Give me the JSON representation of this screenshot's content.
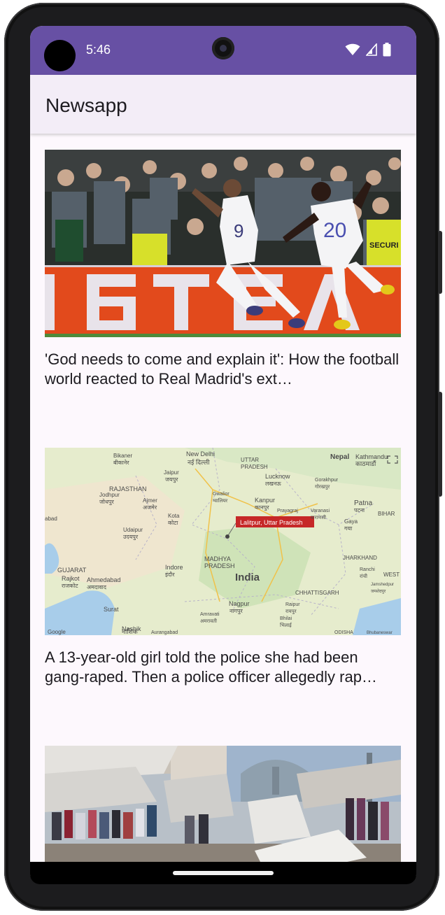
{
  "status_bar": {
    "time": "5:46",
    "icons": [
      "wifi-icon",
      "signal-icon",
      "battery-icon"
    ],
    "color": "#6750a4"
  },
  "app_bar": {
    "title": "Newsapp",
    "color": "#f3edf7"
  },
  "articles": [
    {
      "title": "'God needs to come and explain it': How the football world reacted to Real Madrid's ext…",
      "image": {
        "description_icon": "football-celebration-image",
        "shirt_numbers": [
          "9",
          "20"
        ],
        "sign_text": "SECURI",
        "ad_board": "ST EA"
      }
    },
    {
      "title": "A 13-year-old girl told the police she had been gang-raped. Then a police officer allegedly rap…",
      "image": {
        "description_icon": "map-image",
        "marker_label": "Lalitpur, Uttar Pradesh",
        "map_labels": [
          "Nepal",
          "Kathmandu",
          "काठमाडौं",
          "Bikaner",
          "बीकानेर",
          "New Delhi",
          "नई दिल्ली",
          "UTTAR",
          "PRADESH",
          "RAJASTHAN",
          "Jaipur",
          "जयपुर",
          "Lucknow",
          "लखनऊ",
          "Gorakhpur",
          "गोरखपुर",
          "Jodhpur",
          "जोधपुर",
          "Ajmer",
          "अजमेर",
          "Gwalior",
          "ग्वालियर",
          "Kanpur",
          "कानपुर",
          "Prayagraj",
          "Varanasi",
          "वाराणसी",
          "Patna",
          "पटना",
          "BIHAR",
          "Kota",
          "कोटा",
          "Udaipur",
          "उदयपुर",
          "Gaya",
          "गया",
          "abad",
          "MADHYA",
          "PRADESH",
          "JHARKHAND",
          "Indore",
          "इंदौर",
          "India",
          "Ranchi",
          "रांची",
          "GUJARAT",
          "Rajkot",
          "राजकोट",
          "Ahmedabad",
          "अमदावाद",
          "WEST",
          "Jamshedpur",
          "जमशेदपुर",
          "CHHATTISGARH",
          "Raipur",
          "रायपुर",
          "Nagpur",
          "नागपुर",
          "Surat",
          "Amravati",
          "अमरावती",
          "Bhilai",
          "भिलाई",
          "Nashik",
          "नाशिक",
          "Aurangabad",
          "ODISHA",
          "Bhubaneswar",
          "Google"
        ]
      }
    },
    {
      "title": "",
      "image": {
        "description_icon": "market-stalls-image"
      }
    }
  ]
}
